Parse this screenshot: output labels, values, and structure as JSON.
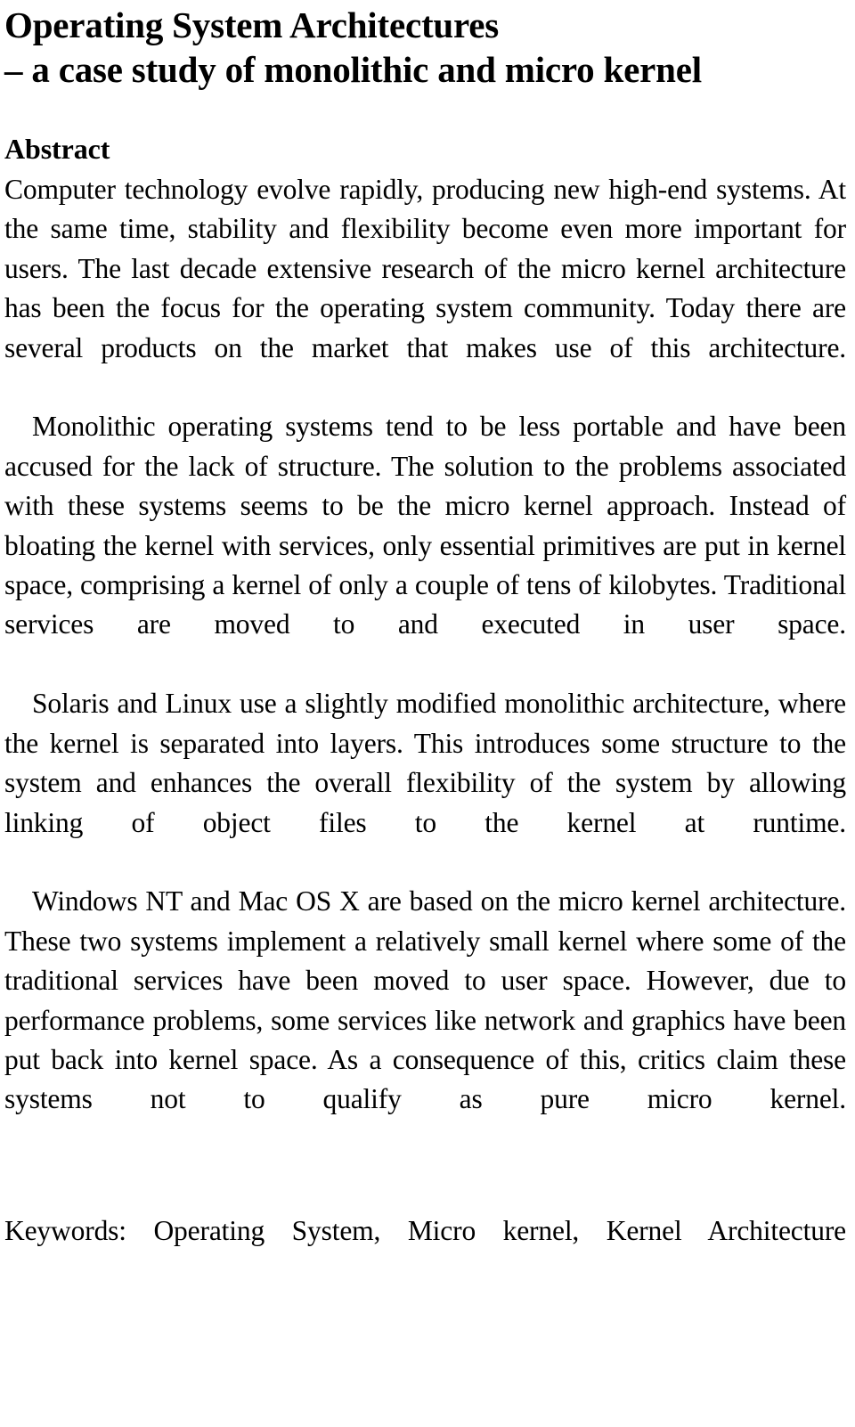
{
  "document": {
    "title": {
      "line_1": "Operating System Architectures",
      "line_2": "– a case study of monolithic and micro kernel"
    },
    "abstract": {
      "heading": "Abstract",
      "paragraphs": [
        "Computer technology evolve rapidly, producing new high-end systems. At the same time, stability and flexibility become even more important for users. The last decade extensive research of the micro kernel architecture has been the focus for the operating system community. Today there are several products on the market that makes use of this architecture.",
        "Monolithic operating systems tend to be less portable and have been accused for the lack of structure. The solution to the problems associated with these systems seems to be the micro kernel approach. Instead of bloating the kernel with services, only essential primitives are put in kernel space, comprising a kernel of only a couple of tens of kilobytes. Traditional services are moved to and executed in user space.",
        "Solaris and Linux use a slightly modified monolithic architecture, where the kernel is separated into layers. This introduces some structure to the system and enhances the overall flexibility of the system by allowing linking of object files to the kernel at runtime.",
        "Windows NT and Mac OS X are based on the micro kernel architecture. These two systems implement a relatively small kernel where some of the traditional services have been moved to user space. However, due to performance problems, some services like network and graphics have been put back into kernel space. As a consequence of this, critics claim these systems not to qualify as pure micro kernel."
      ]
    },
    "keywords": {
      "text": "Keywords: Operating System, Micro kernel, Kernel Architecture"
    },
    "colors": {
      "page_background": "#ffffff",
      "text": "#000000"
    }
  }
}
